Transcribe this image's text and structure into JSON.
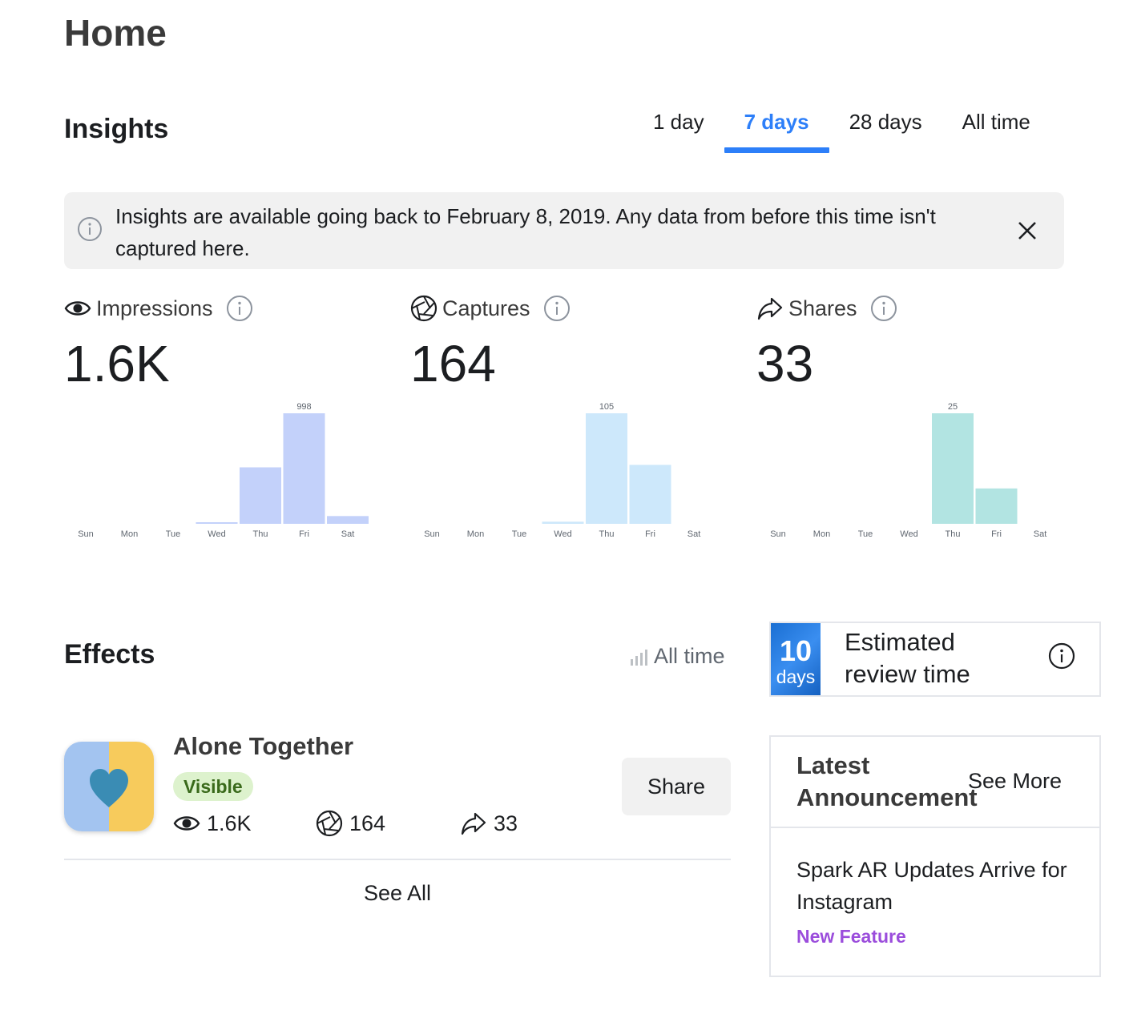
{
  "page": {
    "title": "Home"
  },
  "insights": {
    "title": "Insights",
    "tabs": [
      {
        "label": "1 day",
        "active": false
      },
      {
        "label": "7 days",
        "active": true
      },
      {
        "label": "28 days",
        "active": false
      },
      {
        "label": "All time",
        "active": false
      }
    ],
    "notice": {
      "text": "Insights are available going back to February 8, 2019. Any data from before this time isn't captured here.",
      "icon": "info-icon",
      "close_icon": "close-icon"
    },
    "metrics": [
      {
        "key": "impressions",
        "label": "Impressions",
        "value": "1.6K",
        "icon": "eye-icon"
      },
      {
        "key": "captures",
        "label": "Captures",
        "value": "164",
        "icon": "shutter-icon"
      },
      {
        "key": "shares",
        "label": "Shares",
        "value": "33",
        "icon": "share-arrow-icon"
      }
    ]
  },
  "chart_data": [
    {
      "type": "bar",
      "categories": [
        "Sun",
        "Mon",
        "Tue",
        "Wed",
        "Thu",
        "Fri",
        "Sat"
      ],
      "values": [
        0,
        0,
        0,
        8,
        510,
        998,
        70
      ],
      "peak_label": "998",
      "ylim": [
        0,
        998
      ],
      "color": "#c3d1fa"
    },
    {
      "type": "bar",
      "categories": [
        "Sun",
        "Mon",
        "Tue",
        "Wed",
        "Thu",
        "Fri",
        "Sat"
      ],
      "values": [
        0,
        0,
        0,
        2,
        105,
        56,
        0
      ],
      "peak_label": "105",
      "ylim": [
        0,
        105
      ],
      "color": "#cde8fb"
    },
    {
      "type": "bar",
      "categories": [
        "Sun",
        "Mon",
        "Tue",
        "Wed",
        "Thu",
        "Fri",
        "Sat"
      ],
      "values": [
        0,
        0,
        0,
        0,
        25,
        8,
        0
      ],
      "peak_label": "25",
      "ylim": [
        0,
        25
      ],
      "color": "#b2e4e2"
    }
  ],
  "effects": {
    "title": "Effects",
    "filter_label": "All time",
    "filter_icon": "bar-chart-icon",
    "item": {
      "name": "Alone Together",
      "status": "Visible",
      "impressions": "1.6K",
      "captures": "164",
      "shares": "33",
      "share_button": "Share",
      "thumb_colors": {
        "left": "#a3c4f0",
        "right": "#f7cb5c",
        "heart": "#3a8cb4"
      }
    },
    "see_all": "See All"
  },
  "review": {
    "number": "10",
    "unit": "days",
    "text": "Estimated review time",
    "icon": "info-icon"
  },
  "announcement": {
    "title": "Latest Announcement",
    "see_more": "See More",
    "headline": "Spark AR Updates Arrive for Instagram",
    "tag": "New Feature"
  },
  "colors": {
    "accent": "#2d7ff9",
    "badge_bg": "#ddf2cd",
    "badge_text": "#3a6a1b",
    "tag": "#9b4ddc"
  }
}
